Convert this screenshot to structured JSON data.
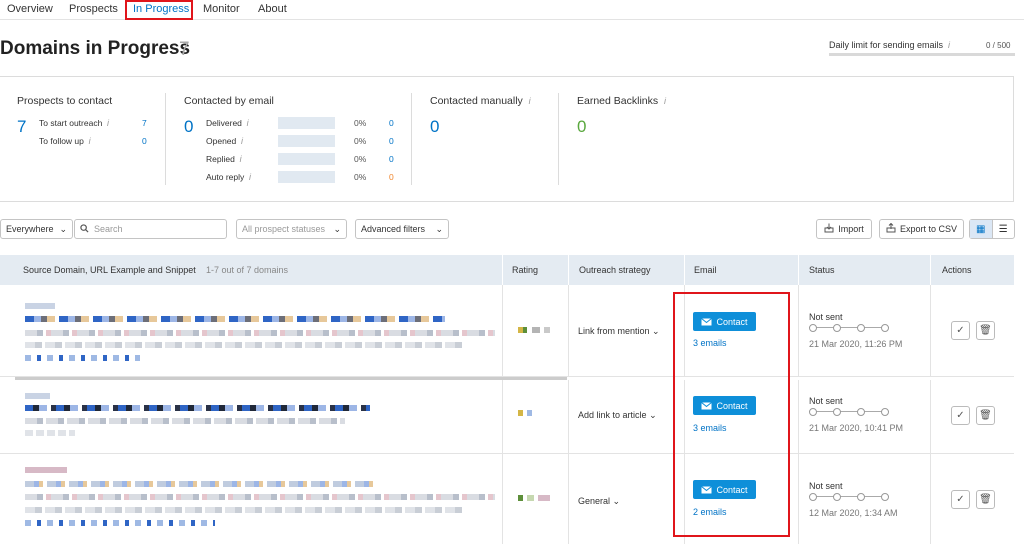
{
  "nav": {
    "tabs": [
      {
        "label": "Overview"
      },
      {
        "label": "Prospects"
      },
      {
        "label": "In Progress"
      },
      {
        "label": "Monitor"
      },
      {
        "label": "About"
      }
    ]
  },
  "header": {
    "title": "Domains in Progress",
    "count": "7",
    "daily_limit_label": "Daily limit for sending emails",
    "daily_limit_value": "0 / 500",
    "daily_limit_fraction": 0
  },
  "stats": {
    "prospects": {
      "title": "Prospects to contact",
      "total": "7",
      "rows": [
        {
          "label": "To start outreach",
          "value": "7"
        },
        {
          "label": "To follow up",
          "value": "0"
        }
      ]
    },
    "contacted_email": {
      "title": "Contacted by email",
      "total": "0",
      "rows": [
        {
          "label": "Delivered",
          "pct": "0%",
          "value": "0"
        },
        {
          "label": "Opened",
          "pct": "0%",
          "value": "0"
        },
        {
          "label": "Replied",
          "pct": "0%",
          "value": "0"
        },
        {
          "label": "Auto reply",
          "pct": "0%",
          "value": "0"
        }
      ]
    },
    "contacted_manually": {
      "title": "Contacted manually",
      "total": "0"
    },
    "earned_backlinks": {
      "title": "Earned Backlinks",
      "total": "0"
    },
    "info_glyph": "i"
  },
  "filters": {
    "location": "Everywhere",
    "search_placeholder": "Search",
    "status_placeholder": "All prospect statuses",
    "advanced": "Advanced filters",
    "import": "Import",
    "export": "Export to CSV"
  },
  "table": {
    "columns": {
      "source": "Source Domain, URL Example and Snippet",
      "range": "1-7 out of 7 domains",
      "rating": "Rating",
      "strategy": "Outreach strategy",
      "email": "Email",
      "status": "Status",
      "actions": "Actions"
    },
    "rows": [
      {
        "strategy": "Link from mention",
        "contact": "Contact",
        "emails": "3 emails",
        "status": "Not sent",
        "date": "21 Mar 2020, 11:26 PM"
      },
      {
        "strategy": "Add link to article",
        "contact": "Contact",
        "emails": "3 emails",
        "status": "Not sent",
        "date": "21 Mar 2020, 10:41 PM"
      },
      {
        "strategy": "General",
        "contact": "Contact",
        "emails": "2 emails",
        "status": "Not sent",
        "date": "12 Mar 2020, 1:34 AM"
      }
    ]
  },
  "colors": {
    "accent": "#0073c6",
    "contact_button": "#0e8fd9",
    "highlight_box": "#e0151b",
    "earned_green": "#5aa83e",
    "auto_reply_orange": "#f0862e"
  },
  "icons": {
    "dropdown": "chevron-down-icon",
    "search": "search-icon",
    "import": "import-icon",
    "export": "export-icon",
    "mail": "mail-icon",
    "check": "check-icon",
    "trash": "trash-icon",
    "table_view": "table-view-icon",
    "list_view": "list-view-icon"
  }
}
